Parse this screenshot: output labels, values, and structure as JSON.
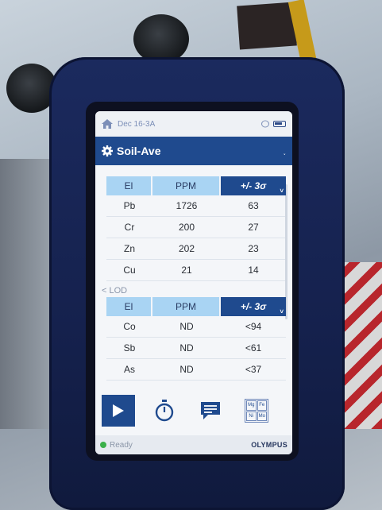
{
  "status_bar": {
    "breadcrumb": "Dec 16-3A"
  },
  "title_bar": {
    "title": "Soil-Ave",
    "menu_chevron": "˯"
  },
  "main_table": {
    "headers": [
      "El",
      "PPM",
      "+/- 3σ"
    ],
    "rows": [
      [
        "Pb",
        "1726",
        "63"
      ],
      [
        "Cr",
        "200",
        "27"
      ],
      [
        "Zn",
        "202",
        "23"
      ],
      [
        "Cu",
        "21",
        "14"
      ]
    ]
  },
  "lod_section": {
    "label": "< LOD",
    "headers": [
      "El",
      "PPM",
      "+/- 3σ"
    ],
    "rows": [
      [
        "Co",
        "ND",
        "<94"
      ],
      [
        "Sb",
        "ND",
        "<61"
      ],
      [
        "As",
        "ND",
        "<37"
      ]
    ]
  },
  "toolbar": {
    "play_icon": "play-icon",
    "timer_icon": "timer-icon",
    "comment_icon": "comment-icon",
    "elements": [
      "Mg",
      "Fe",
      "Ni",
      "Mo"
    ]
  },
  "footer": {
    "status": "Ready",
    "brand": "OLYMPUS"
  },
  "colors": {
    "accent": "#1f4a8e",
    "header_light": "#a9d4f3",
    "ready": "#3bb04a"
  }
}
